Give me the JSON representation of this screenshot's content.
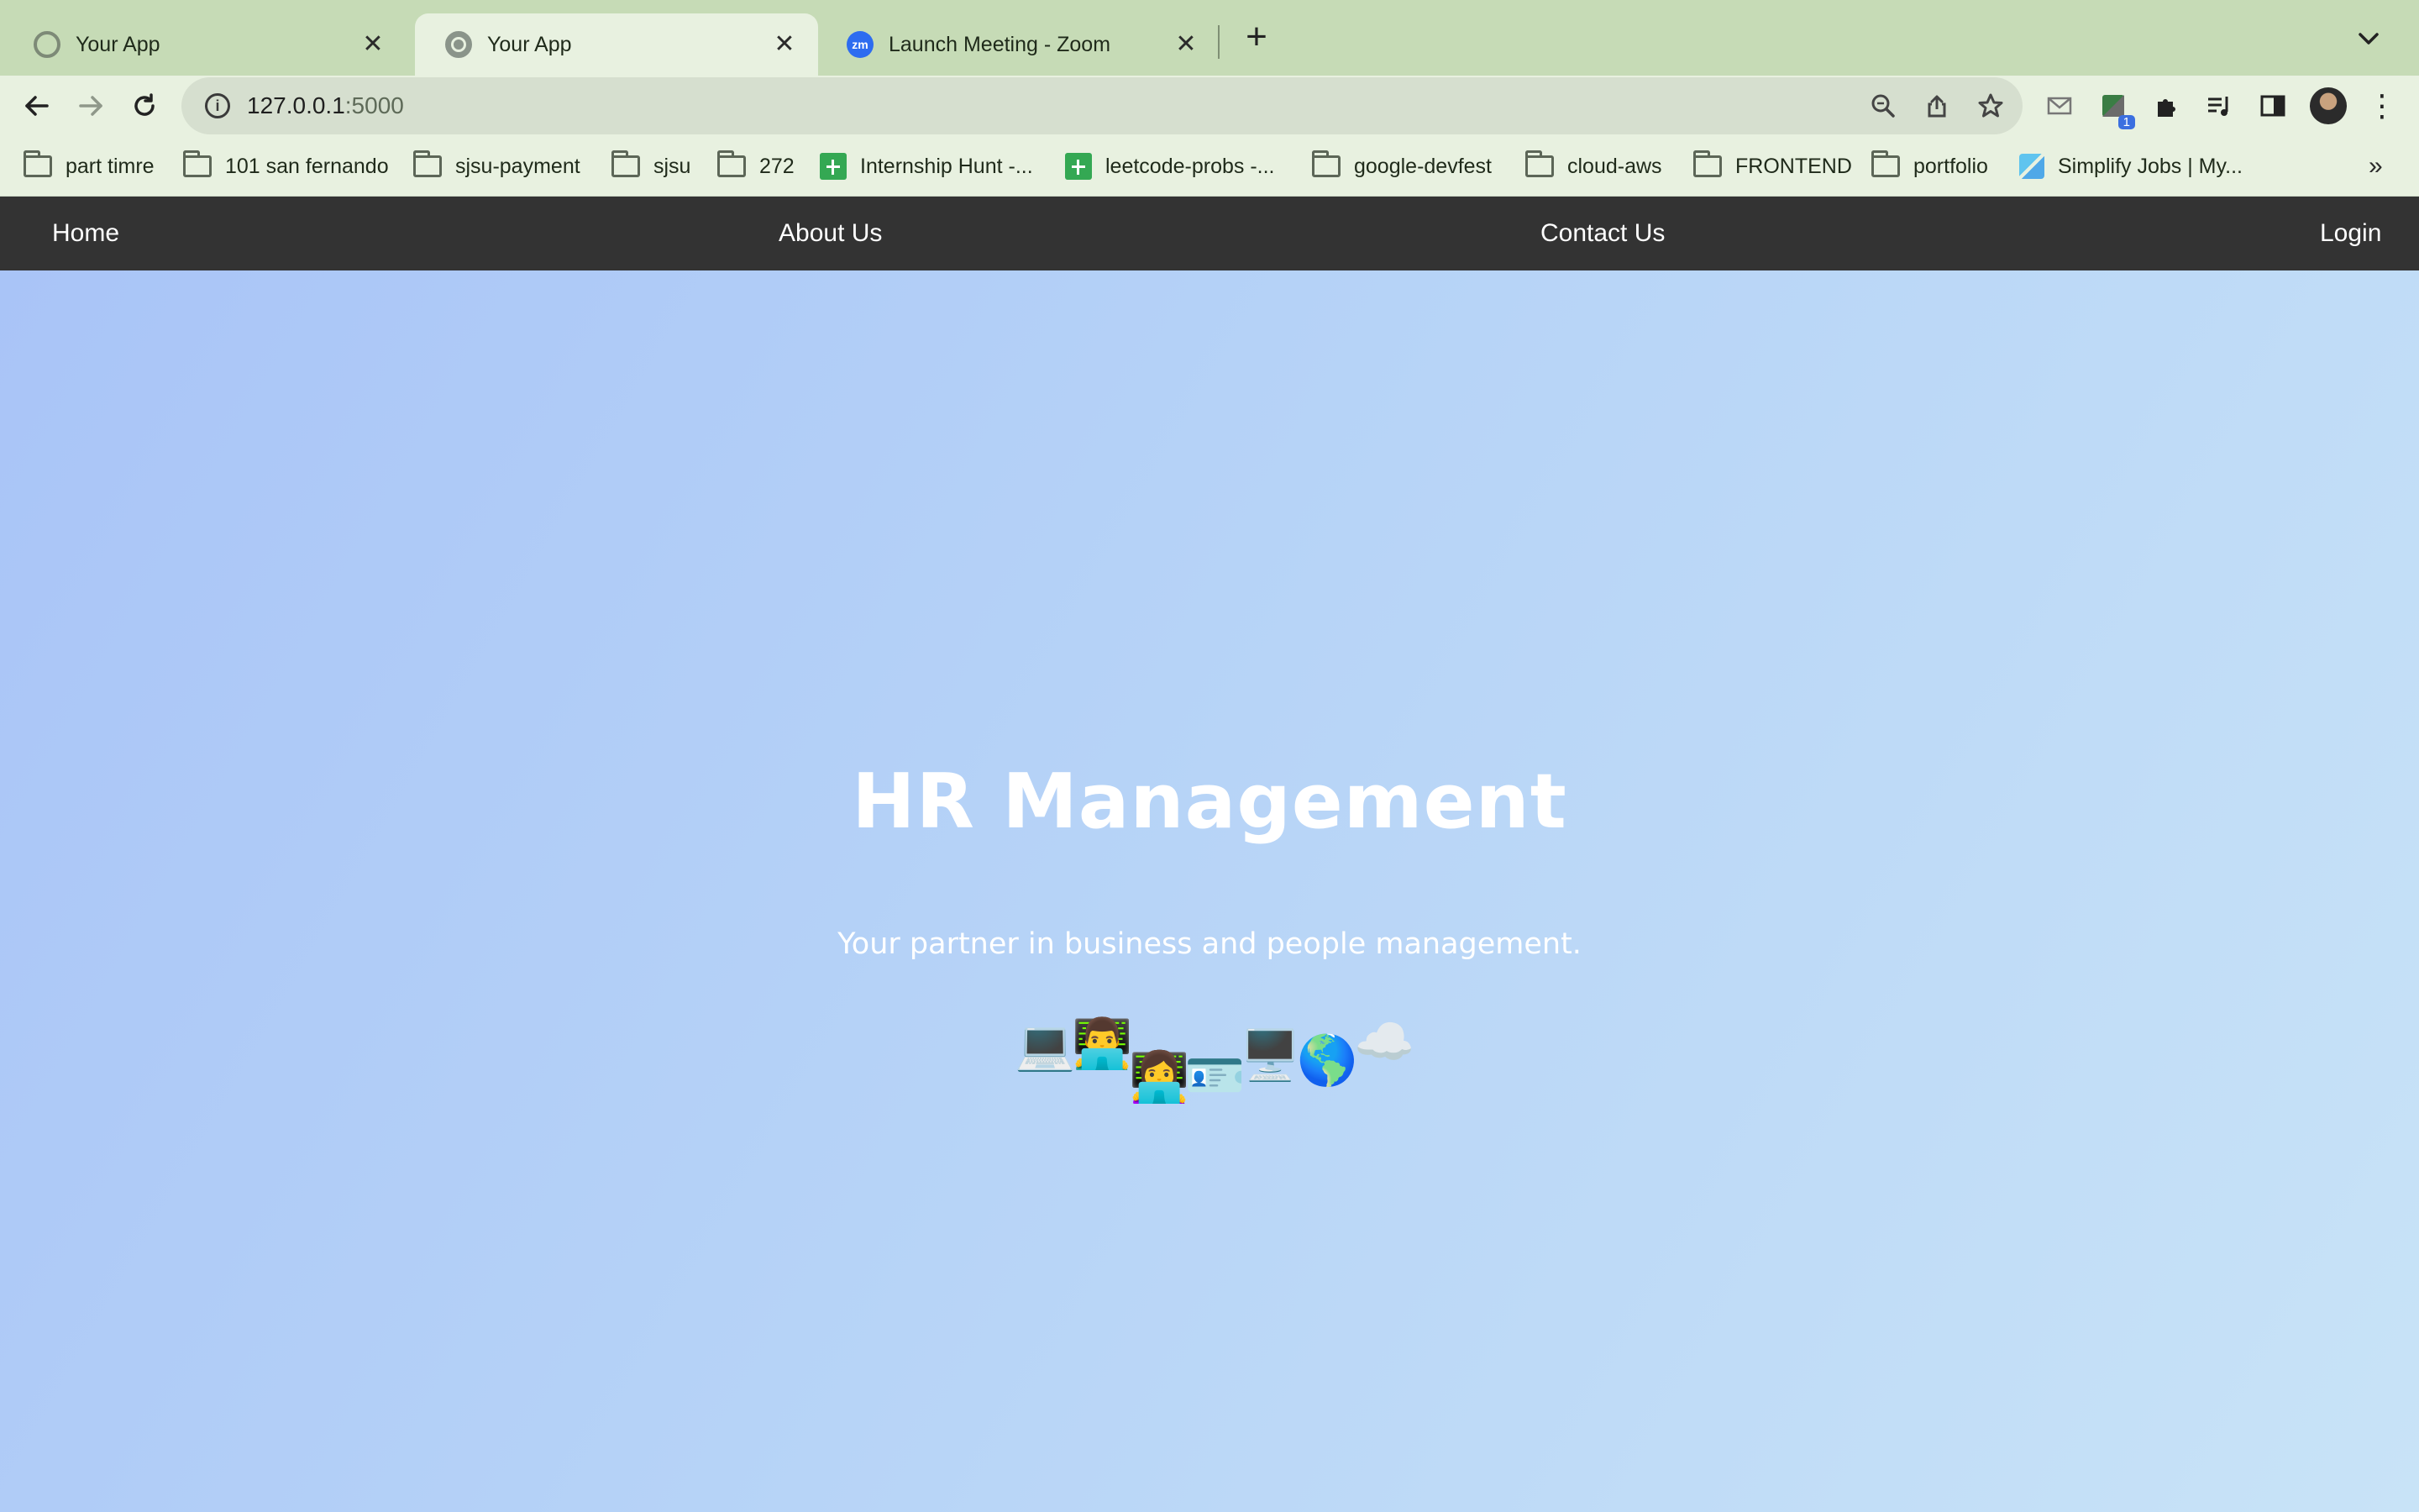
{
  "browser": {
    "tabs": [
      {
        "title": "Your App",
        "icon": "gear-favicon-icon",
        "active": false
      },
      {
        "title": "Your App",
        "icon": "globe-favicon-icon",
        "active": true
      },
      {
        "title": "Launch Meeting - Zoom",
        "icon": "zoom-favicon-icon",
        "active": false
      }
    ],
    "zoom_favicon_text": "zm",
    "close_glyph": "✕",
    "new_tab_glyph": "+",
    "url_host": "127.0.0.1",
    "url_port": ":5000",
    "extension_badge": "1",
    "bookmarks": [
      {
        "label": "part timre",
        "icon": "folder-icon"
      },
      {
        "label": "101 san fernando",
        "icon": "folder-icon"
      },
      {
        "label": "sjsu-payment",
        "icon": "folder-icon"
      },
      {
        "label": "sjsu",
        "icon": "folder-icon"
      },
      {
        "label": "272",
        "icon": "folder-icon"
      },
      {
        "label": "Internship Hunt -...",
        "icon": "sheets-icon"
      },
      {
        "label": "leetcode-probs -...",
        "icon": "sheets-icon"
      },
      {
        "label": "google-devfest",
        "icon": "folder-icon"
      },
      {
        "label": "cloud-aws",
        "icon": "folder-icon"
      },
      {
        "label": "FRONTEND",
        "icon": "folder-icon"
      },
      {
        "label": "portfolio",
        "icon": "folder-icon"
      },
      {
        "label": "Simplify Jobs | My...",
        "icon": "simplify-icon"
      }
    ],
    "bookmarks_overflow": "»"
  },
  "site": {
    "nav": {
      "home": "Home",
      "about": "About Us",
      "contact": "Contact Us",
      "login": "Login"
    },
    "hero": {
      "title": "HR Management",
      "subtitle": "Your partner in business and people management.",
      "emojis": [
        "💻",
        "👨‍💻",
        "👩‍💻",
        "🪪",
        "🖥️",
        "🌎",
        "☁️"
      ]
    }
  }
}
